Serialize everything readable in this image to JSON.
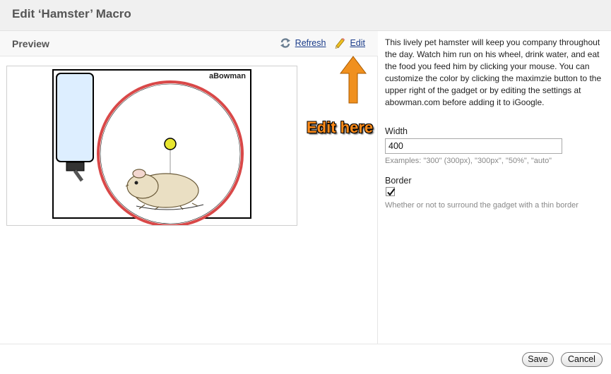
{
  "dialog": {
    "title": "Edit ‘Hamster’ Macro"
  },
  "preview": {
    "label": "Preview",
    "refresh_label": "Refresh",
    "edit_label": "Edit",
    "gadget": {
      "brand": "aBowman"
    }
  },
  "annotation": {
    "text": "Edit here",
    "color": "#ff8c1a"
  },
  "settings": {
    "description": "This lively pet hamster will keep you company throughout the day. Watch him run on his wheel, drink water, and eat the food you feed him by clicking your mouse. You can customize the color by clicking the maximzie button to the upper right of the gadget or by editing the settings at abowman.com before adding it to iGoogle.",
    "width": {
      "label": "Width",
      "value": "400",
      "help": "Examples: \"300\" (300px), \"300px\", \"50%\", \"auto\""
    },
    "border": {
      "label": "Border",
      "checked": true,
      "help": "Whether or not to surround the gadget with a thin border"
    }
  },
  "footer": {
    "save_label": "Save",
    "cancel_label": "Cancel"
  },
  "colors": {
    "wheel": "#d94848",
    "bottle": "#ddeeff",
    "ball": "#e8e630",
    "hamster": "#eadfc3",
    "link": "#1a3c8a"
  }
}
